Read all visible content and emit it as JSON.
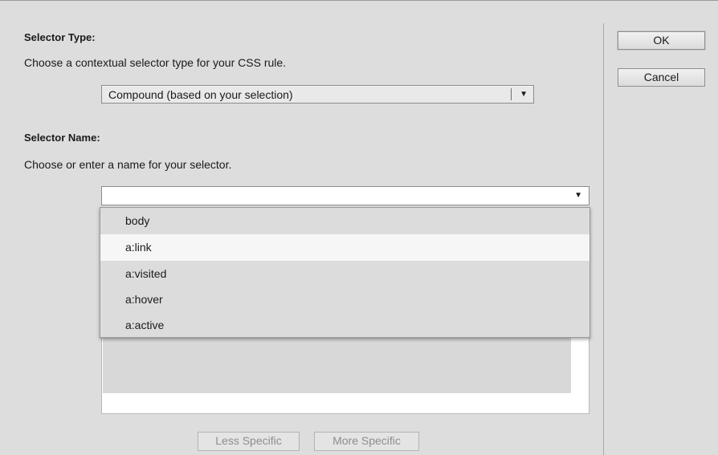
{
  "selector_type": {
    "heading": "Selector Type:",
    "instruction": "Choose a contextual selector type for your CSS rule.",
    "selected_value": "Compound (based on your selection)"
  },
  "selector_name": {
    "heading": "Selector Name:",
    "instruction": "Choose or enter a name for your selector.",
    "input_value": "",
    "dropdown_options": [
      "body",
      "a:link",
      "a:visited",
      "a:hover",
      "a:active"
    ],
    "highlighted_option": "a:link"
  },
  "buttons": {
    "ok": "OK",
    "cancel": "Cancel",
    "less_specific": "Less Specific",
    "more_specific": "More Specific"
  },
  "icons": {
    "dropdown_arrow": "▼"
  }
}
